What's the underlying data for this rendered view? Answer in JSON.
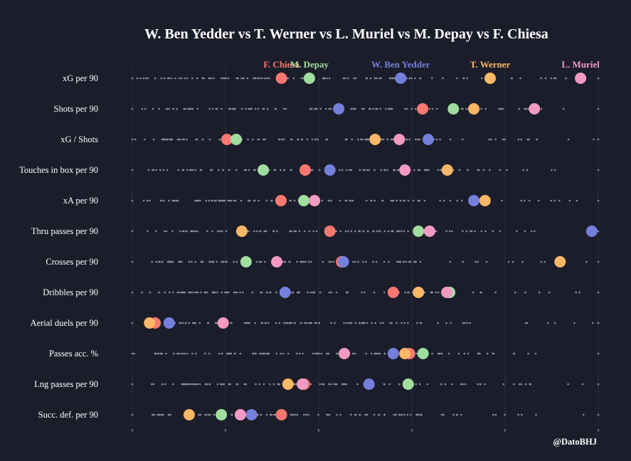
{
  "chart_data": {
    "type": "scatter",
    "title": "W. Ben Yedder vs T. Werner vs L. Muriel vs M. Depay vs F. Chiesa",
    "credit": "@DatoBHJ",
    "xlim": [
      0,
      1
    ],
    "grid": true,
    "metrics": [
      "xG per 90",
      "Shots per 90",
      "xG / Shots",
      "Touches in box per 90",
      "xA per 90",
      "Thru passes per 90",
      "Crosses per 90",
      "Dribbles per 90",
      "Aerial duels per 90",
      "Passes acc. %",
      "Lng passes per 90",
      "Succ. def. per 90"
    ],
    "series": [
      {
        "name": "F. Chiesa",
        "color": "#fb7871",
        "values": [
          0.32,
          0.623,
          0.203,
          0.371,
          0.319,
          0.424,
          0.449,
          0.56,
          0.049,
          0.595,
          0.369,
          0.32
        ]
      },
      {
        "name": "M. Depay",
        "color": "#a0dea0",
        "values": [
          0.38,
          0.689,
          0.223,
          0.281,
          0.368,
          0.614,
          0.244,
          0.681,
          null,
          0.624,
          0.592,
          0.191
        ]
      },
      {
        "name": "W. Ben Yedder",
        "color": "#7480dc",
        "values": [
          0.576,
          0.443,
          0.635,
          0.424,
          0.733,
          0.986,
          0.453,
          0.328,
          0.079,
          0.56,
          0.508,
          0.256
        ]
      },
      {
        "name": "T. Werner",
        "color": "#ffb866",
        "values": [
          0.768,
          0.733,
          0.521,
          0.676,
          0.757,
          0.235,
          0.918,
          0.614,
          0.037,
          0.585,
          0.334,
          0.122
        ]
      },
      {
        "name": "L. Muriel",
        "color": "#f29ac4",
        "values": [
          0.962,
          0.863,
          0.573,
          0.585,
          0.391,
          0.638,
          0.31,
          0.675,
          0.195,
          0.455,
          0.365,
          0.232
        ]
      }
    ],
    "background_color": "#1b1d2a"
  }
}
